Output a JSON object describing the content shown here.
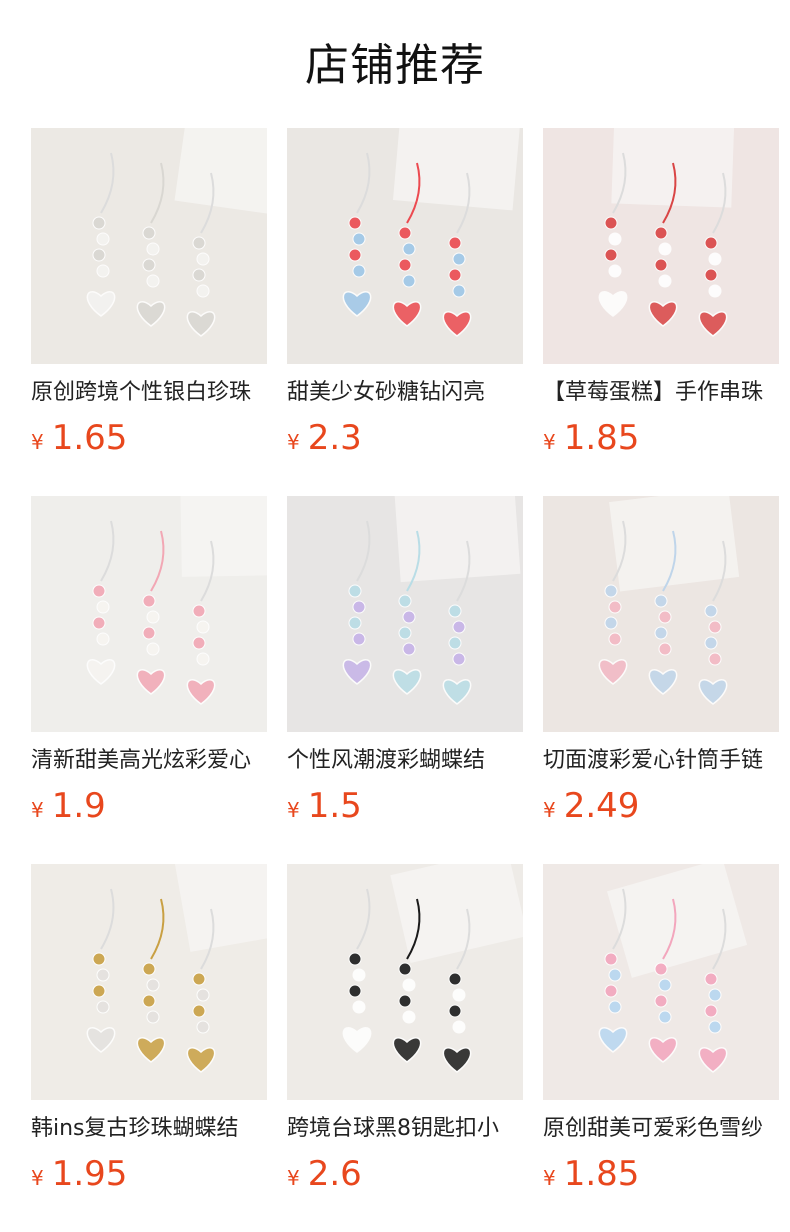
{
  "header": {
    "title": "店铺推荐"
  },
  "currency_symbol": "¥",
  "products": [
    {
      "title": "原创跨境个性银白珍珠",
      "price": "1.65",
      "colors": {
        "bg": "#ece9e4",
        "accent": "#d9d7d2",
        "gem": "#f4f3f1"
      }
    },
    {
      "title": "甜美少女砂糖钻闪亮",
      "price": "2.3",
      "colors": {
        "bg": "#eae7e3",
        "accent": "#ec4a50",
        "gem": "#9ec7e8"
      }
    },
    {
      "title": "【草莓蛋糕】手作串珠",
      "price": "1.85",
      "colors": {
        "bg": "#efe5e3",
        "accent": "#d94545",
        "gem": "#ffffff"
      }
    },
    {
      "title": "清新甜美高光炫彩爱心",
      "price": "1.9",
      "colors": {
        "bg": "#efeeeb",
        "accent": "#f2a7b4",
        "gem": "#f7f5f1"
      }
    },
    {
      "title": "个性风潮渡彩蝴蝶结",
      "price": "1.5",
      "colors": {
        "bg": "#e7e5e4",
        "accent": "#b9dde6",
        "gem": "#c6b3e8"
      }
    },
    {
      "title": "切面渡彩爱心针筒手链",
      "price": "2.49",
      "colors": {
        "bg": "#ece6e2",
        "accent": "#bfd5ea",
        "gem": "#f3b8c4"
      }
    },
    {
      "title": "韩ins复古珍珠蝴蝶结",
      "price": "1.95",
      "colors": {
        "bg": "#efece7",
        "accent": "#c9a043",
        "gem": "#e4e2df"
      }
    },
    {
      "title": "跨境台球黑8钥匙扣小",
      "price": "2.6",
      "colors": {
        "bg": "#eeebe7",
        "accent": "#1a1a1a",
        "gem": "#ffffff"
      }
    },
    {
      "title": "原创甜美可爱彩色雪纱",
      "price": "1.85",
      "colors": {
        "bg": "#efe9e6",
        "accent": "#f3a6bd",
        "gem": "#b7d7f1"
      }
    }
  ]
}
